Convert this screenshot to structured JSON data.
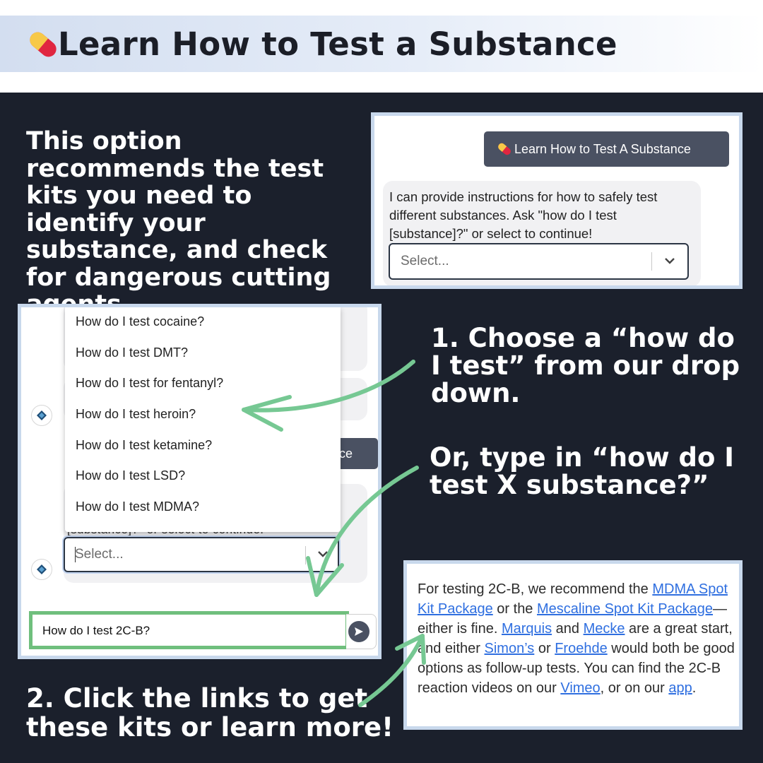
{
  "header": {
    "title": "Learn How to Test a Substance",
    "icon": "pill-icon",
    "band_color": "#d3def0"
  },
  "panel": {
    "background": "#1b202c"
  },
  "intro_text": "This option recommends the test kits you need to identify your substance, and check for dangerous cutting agents.",
  "step1_text": "1. Choose a “how do I test” from our drop down.",
  "or_text": "Or, type in “how do I test X substance?”",
  "step2_text": "2. Click the links to get these kits or learn more!",
  "shot_a": {
    "button_label": "Learn How to Test A Substance",
    "bot_message": "I can provide instructions for how to safely test different substances. Ask \"how do I test [substance]?\" or select to continue!",
    "select_placeholder": "Select..."
  },
  "shot_b": {
    "dropdown_options": [
      "How do I test cocaine?",
      "How do I test DMT?",
      "How do I test for fentanyl?",
      "How do I test heroin?",
      "How do I test ketamine?",
      "How do I test LSD?",
      "How do I test MDMA?"
    ],
    "hidden_button_fragment": "ance",
    "partial_message": "[substance]?\" or select to continue.",
    "select_placeholder": "Select...",
    "chat_input_value": "How do I test 2C-B?",
    "highlight_color": "#6fbf7d"
  },
  "shot_c": {
    "p1": "For testing 2C-B, we recommend the ",
    "link_mdma": "MDMA Spot Kit Package",
    "p2": " or the ",
    "link_mescaline": "Mescaline Spot Kit Package",
    "p3": "—either is fine. ",
    "link_marquis": "Marquis",
    "p4": " and ",
    "link_mecke": "Mecke",
    "p5": " are a great start, and either ",
    "link_simons": "Simon’s",
    "p6": " or ",
    "link_froehde": "Froehde",
    "p7": " would both be good options as follow-up tests. You can find the 2C-B reaction videos on our ",
    "link_vimeo": "Vimeo",
    "p8": ", or on our ",
    "link_app": "app",
    "p9": ".",
    "link_color": "#2f6fe0"
  },
  "arrow_color": "#76c893"
}
